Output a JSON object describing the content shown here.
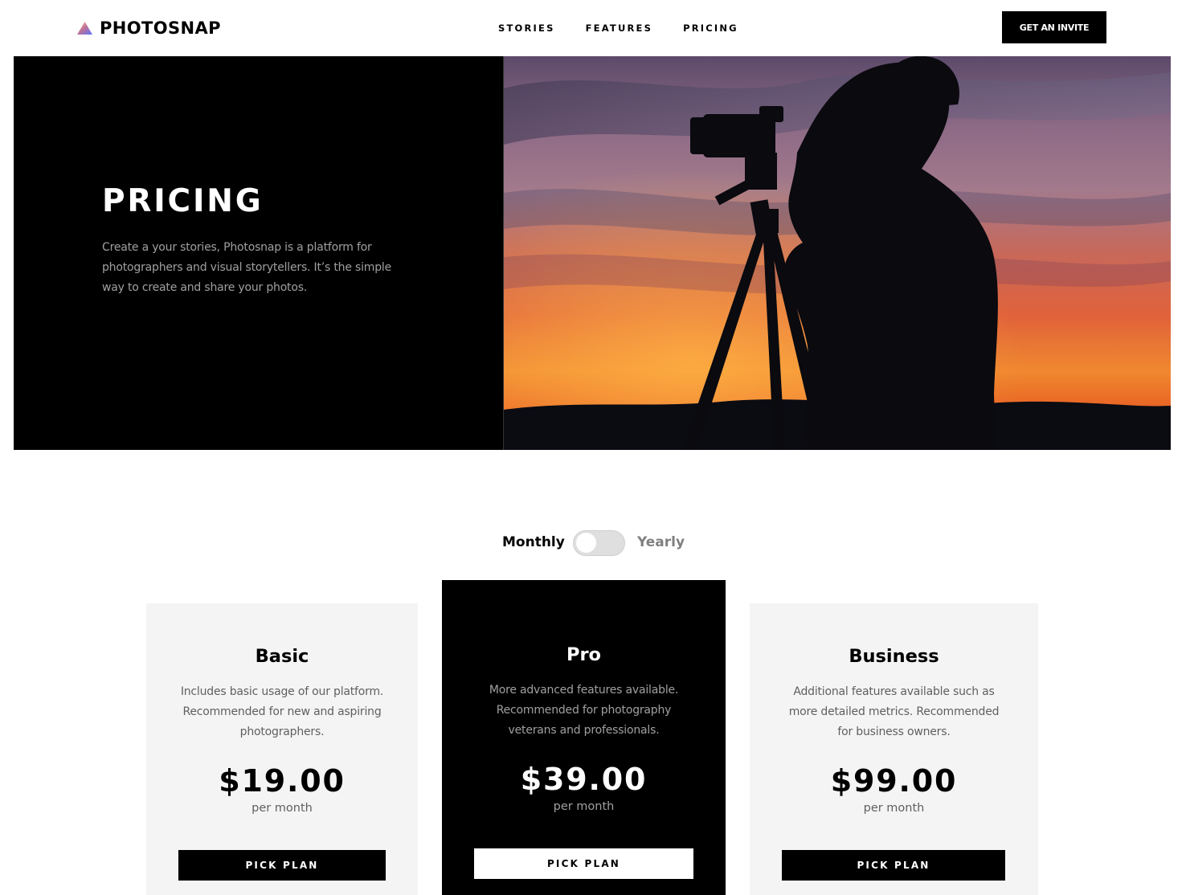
{
  "brand": {
    "name": "PHOTOSNAP",
    "logo_gradient": [
      "#FFC593",
      "#BC7198",
      "#5A77FF"
    ]
  },
  "nav": {
    "links": [
      {
        "label": "STORIES"
      },
      {
        "label": "FEATURES"
      },
      {
        "label": "PRICING"
      }
    ],
    "cta_label": "GET AN INVITE"
  },
  "hero": {
    "title": "PRICING",
    "description": "Create a your stories, Photosnap is a platform for photographers and visual storytellers. It’s the simple way to create and share your photos.",
    "image": "silhouette-photographer-sunset"
  },
  "billing_toggle": {
    "monthly_label": "Monthly",
    "yearly_label": "Yearly",
    "selected": "Monthly"
  },
  "plans": [
    {
      "name": "Basic",
      "description": "Includes basic usage of our platform. Recommended for new and aspiring photographers.",
      "price": "$19.00",
      "period": "per month",
      "button_label": "PICK PLAN",
      "highlighted": false
    },
    {
      "name": "Pro",
      "description": "More advanced features available. Recommended for photography veterans and professionals.",
      "price": "$39.00",
      "period": "per month",
      "button_label": "PICK PLAN",
      "highlighted": true
    },
    {
      "name": "Business",
      "description": "Additional features available such as more detailed metrics. Recommended for business owners.",
      "price": "$99.00",
      "period": "per month",
      "button_label": "PICK PLAN",
      "highlighted": false
    }
  ],
  "colors": {
    "primary": "#000000",
    "background": "#FFFFFF",
    "card_background": "#F4F4F4",
    "toggle_track": "#DFDFDF"
  }
}
